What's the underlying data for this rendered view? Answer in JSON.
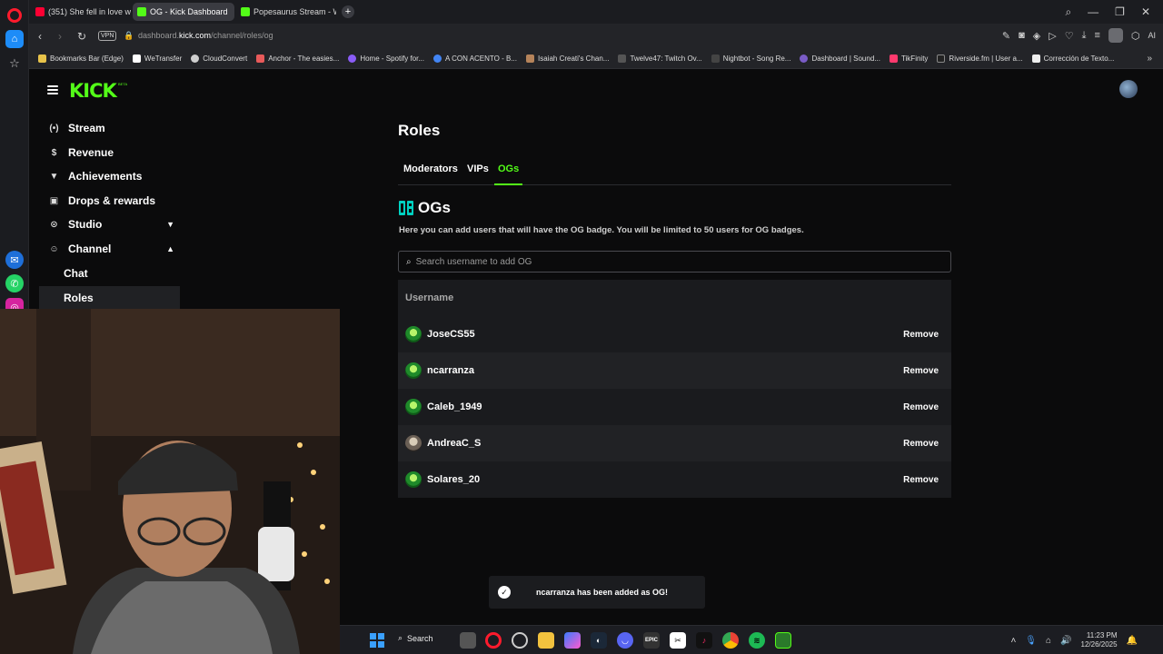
{
  "browser": {
    "tabs": [
      {
        "label": "(351) She fell in love with",
        "color": "#ff0033"
      },
      {
        "label": "OG - Kick Dashboard",
        "color": "#53fc18"
      },
      {
        "label": "Popesaurus Stream - Wat",
        "color": "#53fc18"
      }
    ],
    "new_tab": "+",
    "vpn": "VPN",
    "url_prefix": "dashboard.",
    "url_domain": "kick.com",
    "url_path": "/channel/roles/og",
    "bookmarks": [
      "Bookmarks Bar (Edge)",
      "WeTransfer",
      "CloudConvert",
      "Anchor - The easies...",
      "Home - Spotify for...",
      "A CON ACENTO - B...",
      "Isaiah Creati's Chan...",
      "Twelve47: Twitch Ov...",
      "Nightbot - Song Re...",
      "Dashboard | Sound...",
      "TikFinity",
      "Riverside.fm | User a...",
      "Corrección de Texto..."
    ],
    "ai_label": "AI"
  },
  "app": {
    "logo": "KICK",
    "beta": "BETA"
  },
  "sidebar": {
    "items": [
      {
        "label": "Stream",
        "icon": "broadcast-icon"
      },
      {
        "label": "Revenue",
        "icon": "dollar-icon"
      },
      {
        "label": "Achievements",
        "icon": "trophy-icon"
      },
      {
        "label": "Drops & rewards",
        "icon": "gift-icon"
      },
      {
        "label": "Studio",
        "icon": "studio-icon"
      },
      {
        "label": "Channel",
        "icon": "users-icon"
      }
    ],
    "sub_items": [
      {
        "label": "Chat"
      },
      {
        "label": "Roles"
      }
    ]
  },
  "main": {
    "title": "Roles",
    "tabs": [
      "Moderators",
      "VIPs",
      "OGs"
    ],
    "active_tab": "OGs",
    "section_title": "OGs",
    "description": "Here you can add users that will have the OG badge. You will be limited to 50 users for OG badges.",
    "search_placeholder": "Search username to add OG",
    "table_header": "Username",
    "remove_label": "Remove",
    "users": [
      "JoseCS55",
      "ncarranza",
      "Caleb_1949",
      "AndreaC_S",
      "Solares_20"
    ]
  },
  "toast": {
    "message": "ncarranza has been added as OG!"
  },
  "taskbar": {
    "search_label": "Search",
    "time": "11:23 PM",
    "date": "12/26/2025"
  },
  "colors": {
    "accent": "#53fc18",
    "background": "#0b0b0c",
    "panel": "#1a1b1e"
  }
}
